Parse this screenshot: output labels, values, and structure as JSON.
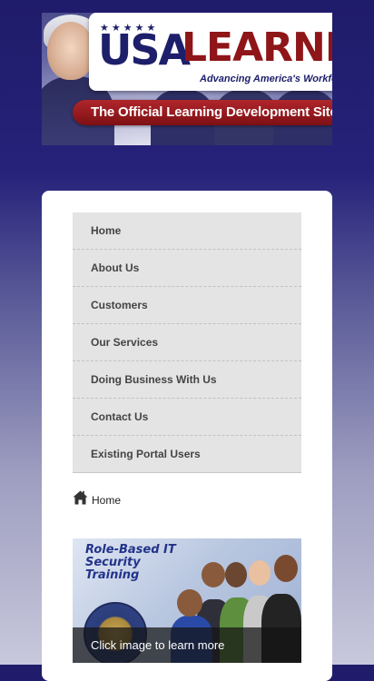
{
  "banner": {
    "stars": "★★★★★",
    "logo_usa": "USA",
    "logo_learning": "LEARNING",
    "tagline": "Advancing America's Workforce",
    "subtitle": "The Official Learning Development Site for the Federal Government"
  },
  "nav": {
    "items": [
      {
        "label": "Home"
      },
      {
        "label": "About Us"
      },
      {
        "label": "Customers"
      },
      {
        "label": "Our Services"
      },
      {
        "label": "Doing Business With Us"
      },
      {
        "label": "Contact Us"
      },
      {
        "label": "Existing Portal Users"
      }
    ]
  },
  "breadcrumb": {
    "icon": "home-icon",
    "label": "Home"
  },
  "promo": {
    "title": "Role-Based IT Security Training",
    "caption": "Click image to learn more"
  },
  "colors": {
    "navy": "#1d1f6b",
    "brand_red": "#8e1518",
    "nav_bg": "#e4e4e4"
  }
}
